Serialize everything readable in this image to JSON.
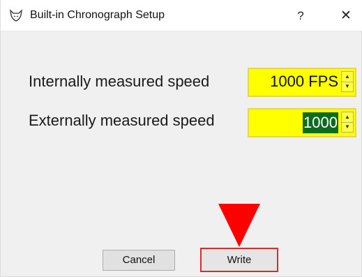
{
  "window": {
    "title": "Built-in Chronograph Setup",
    "help_label": "?",
    "close_label": "✕",
    "icon": "wolf-logo-icon"
  },
  "fields": {
    "internal": {
      "label": "Internally measured speed",
      "value": "1000 FPS",
      "highlight_color": "#ffff00"
    },
    "external": {
      "label": "Externally measured speed",
      "value": "1000",
      "selected": true,
      "selection_color": "#0b6b1f"
    }
  },
  "spin_icons": {
    "up": "▲",
    "down": "▼"
  },
  "annotation": {
    "arrow_color": "#ff0000",
    "points_to": "write-button"
  },
  "buttons": {
    "cancel": "Cancel",
    "write": "Write",
    "write_border_color": "#d62b2b"
  }
}
